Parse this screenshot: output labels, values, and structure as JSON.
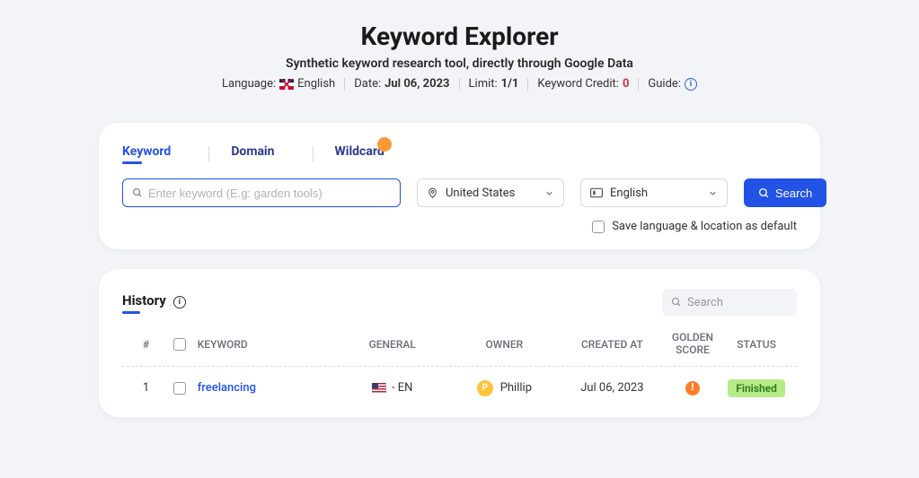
{
  "title": "Keyword Explorer",
  "subtitle": "Synthetic keyword research tool, directly through Google Data",
  "meta": {
    "language_label": "Language:",
    "language_value": "English",
    "date_label": "Date:",
    "date_value": "Jul 06, 2023",
    "limit_label": "Limit:",
    "limit_value": "1/1",
    "credit_label": "Keyword Credit:",
    "credit_value": "0",
    "guide_label": "Guide:"
  },
  "tabs": {
    "keyword": "Keyword",
    "domain": "Domain",
    "wildcard": "Wildcard"
  },
  "search": {
    "input_placeholder": "Enter keyword (E.g: garden tools)",
    "location": "United States",
    "language": "English",
    "button": "Search",
    "save_label": "Save language & location as default"
  },
  "history": {
    "title": "History",
    "search_placeholder": "Search",
    "columns": {
      "num": "#",
      "keyword": "KEYWORD",
      "general": "GENERAL",
      "owner": "OWNER",
      "created": "CREATED AT",
      "golden": "GOLDEN SCORE",
      "status": "STATUS"
    },
    "rows": [
      {
        "num": "1",
        "keyword": "freelancing",
        "general": "- EN",
        "owner": "Phillip",
        "owner_initial": "P",
        "created": "Jul 06, 2023",
        "status": "Finished"
      }
    ]
  }
}
